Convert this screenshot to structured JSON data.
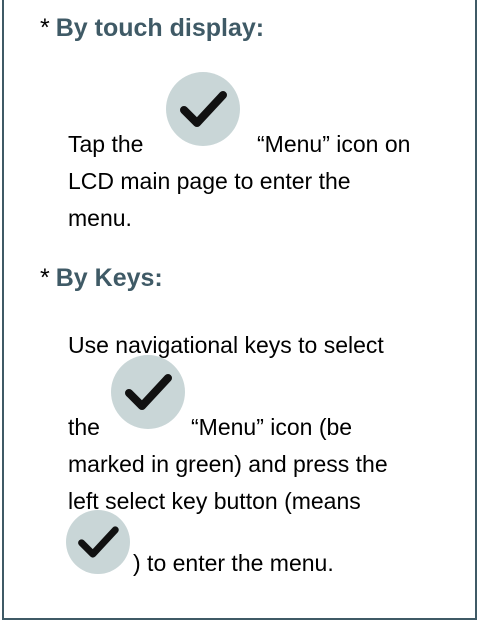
{
  "section1": {
    "star": "*",
    "heading": "By touch display:",
    "line1_prefix": "Tap the",
    "line1_suffix": "“Menu” icon on",
    "line2": "LCD main page to enter the",
    "line3": "menu."
  },
  "section2": {
    "star": "*",
    "heading": "By Keys:",
    "line1": "Use navigational keys to select",
    "line2_prefix": "the",
    "line2_suffix": "“Menu” icon (be",
    "line3": "marked in green) and press the",
    "line4": "left select key button (means",
    "line5": ") to enter the menu."
  },
  "icons": {
    "menu_icon": "check-circle-icon",
    "fill": "#c9d6d7",
    "check": "#111111"
  }
}
